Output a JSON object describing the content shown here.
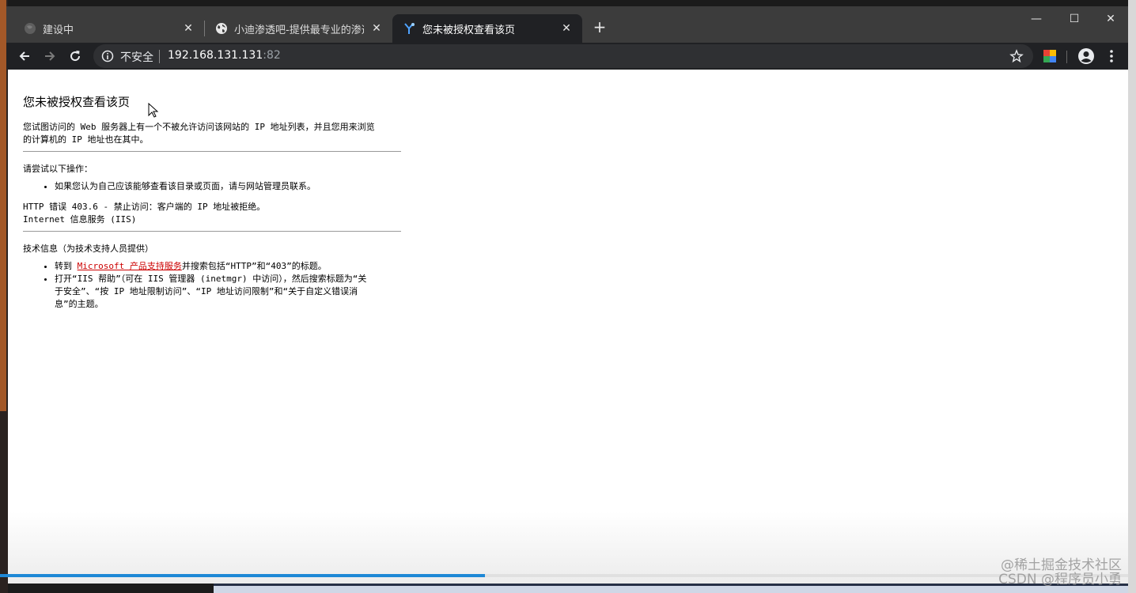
{
  "browser": {
    "tabs": [
      {
        "title": "建设中",
        "favicon": "gray-globe-icon",
        "active": false
      },
      {
        "title": "小迪渗透吧-提供最专业的渗透测",
        "favicon": "globe-icon",
        "active": false
      },
      {
        "title": "您未被授权查看该页",
        "favicon": "iis-icon",
        "active": true
      }
    ],
    "close_glyph": "✕",
    "new_tab_glyph": "+",
    "window_controls": {
      "minimize": "—",
      "maximize": "☐",
      "close": "✕"
    },
    "address": {
      "security_label": "不安全",
      "host": "192.168.131.131",
      "port": ":82"
    },
    "accent_color": "#1e88d6"
  },
  "page": {
    "title": "您未被授权查看该页",
    "intro_lines": [
      "您试图访问的 Web 服务器上有一个不被允许访问该网站的 IP 地址列表，并且您用来浏览",
      "的计算机的 IP 地址也在其中。"
    ],
    "try_heading": "请尝试以下操作：",
    "try_item": "如果您认为自己应该能够查看该目录或页面，请与网站管理员联系。",
    "error_line1": "HTTP 错误 403.6 - 禁止访问：客户端的 IP 地址被拒绝。",
    "error_line2": "Internet 信息服务 (IIS)",
    "tech_heading": "技术信息（为技术支持人员提供）",
    "tech_item1_prefix": "转到 ",
    "tech_item1_link": "Microsoft 产品支持服务",
    "tech_item1_suffix": "并搜索包括“HTTP”和“403”的标题。",
    "tech_item2_lines": [
      "打开“IIS 帮助”（可在 IIS 管理器 (inetmgr) 中访问），然后搜索标题为“关",
      "于安全”、“按 IP 地址限制访问”、“IP 地址访问限制”和“关于自定义错误消",
      "息”的主题。"
    ]
  },
  "video_progress": 0.43,
  "watermark": {
    "line1": "@稀土掘金技术社区",
    "line2": "CSDN @程序员小勇"
  }
}
